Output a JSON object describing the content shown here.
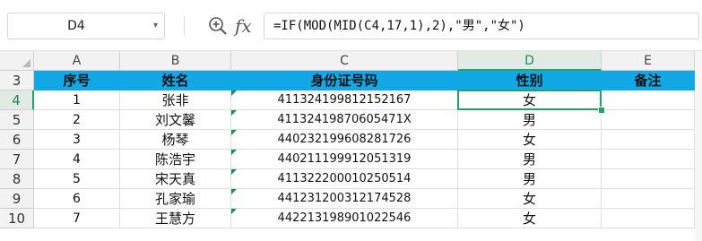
{
  "formula_bar": {
    "name_box": "D4",
    "name_box_dropdown_icon": "chevron-down-icon",
    "zoom_icon": "magnifier-zoom-icon",
    "fx_label": "fx",
    "formula": "=IF(MOD(MID(C4,17,1),2),\"男\",\"女\")"
  },
  "grid": {
    "columns": [
      "A",
      "B",
      "C",
      "D",
      "E"
    ],
    "active_column": "D",
    "active_row": "4",
    "rows": [
      {
        "row": "3",
        "cells": [
          "序号",
          "姓名",
          "身份证号码",
          "性别",
          "备注"
        ],
        "header": true
      },
      {
        "row": "4",
        "cells": [
          "1",
          "张非",
          "411324199812152167",
          "女",
          ""
        ]
      },
      {
        "row": "5",
        "cells": [
          "2",
          "刘文馨",
          "41132419870605471X",
          "男",
          ""
        ]
      },
      {
        "row": "6",
        "cells": [
          "3",
          "杨琴",
          "440232199608281726",
          "女",
          ""
        ]
      },
      {
        "row": "7",
        "cells": [
          "4",
          "陈浩宇",
          "440211199912051319",
          "男",
          ""
        ]
      },
      {
        "row": "8",
        "cells": [
          "5",
          "宋天真",
          "411322200010250514",
          "男",
          ""
        ]
      },
      {
        "row": "9",
        "cells": [
          "6",
          "孔家瑜",
          "441231200312174528",
          "女",
          ""
        ]
      },
      {
        "row": "10",
        "cells": [
          "7",
          "王慧方",
          "442213198901022546",
          "女",
          ""
        ]
      }
    ]
  },
  "colors": {
    "header_fill": "#12a8e6",
    "selection": "#21a366",
    "text_flag": "#1e8c4a"
  }
}
